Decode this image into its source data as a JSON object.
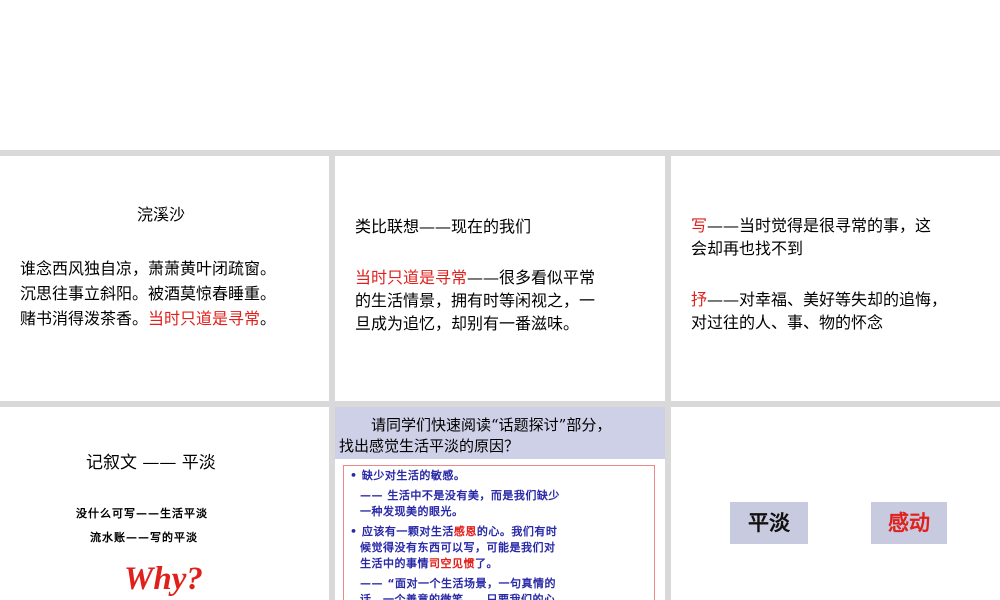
{
  "cell1": {
    "title": "浣溪沙",
    "line1": "谁念西风独自凉，萧萧黄叶闭疏窗。",
    "line2": "沉思往事立斜阳。被酒莫惊春睡重。",
    "line3_prefix": "赌书消得泼茶香。",
    "line3_highlight": "当时只道是寻常",
    "line3_suffix": "。"
  },
  "cell2": {
    "title": "类比联想——现在的我们",
    "highlight": "当时只道是寻常",
    "line1_rest": "——很多看似平常",
    "line2": "的生活情景，拥有时等闲视之，一",
    "line3": "旦成为追忆，却别有一番滋味。"
  },
  "cell3": {
    "a_key": "写",
    "a_line1_rest": "——当时觉得是很寻常的事，这",
    "a_line2": "会却再也找不到",
    "b_key": "抒",
    "b_line1_rest": "——对幸福、美好等失却的追悔，",
    "b_line2": "对过往的人、事、物的怀念"
  },
  "cell4": {
    "title": "记叙文 —— 平淡",
    "line1": "没什么可写——生活平淡",
    "line2": "流水账——写的平淡",
    "why": "Why?"
  },
  "cell5": {
    "question_line1": "请同学们快速阅读“话题探讨”部分，",
    "question_line2": "找出感觉生活平淡的原因？",
    "box": {
      "l1": "• 缺少对生活的敏感。",
      "l2": "—— 生活中不是没有美，而是我们缺少",
      "l3": "一种发现美的眼光。",
      "l4_a": "• 应该有一颗对生活",
      "l4_hl": "感恩",
      "l4_b": "的心。我们有时",
      "l5": "候觉得没有东西可以写，可能是我们对",
      "l6_a": "生活中的事情",
      "l6_hl": "司空见惯",
      "l6_b": "了。",
      "l7": "—— “面对一个生活场景，一句真情的",
      "l8": "话，一个善意的微笑……只要我们的心"
    }
  },
  "cell6": {
    "tag1": "平淡",
    "tag2": "感动"
  },
  "colors": {
    "highlight_red": "#e0201c",
    "box_text_blue": "#2a2aa8",
    "tag_bg": "#c8cbdf",
    "question_bg": "#cdd0e6",
    "grid_gap": "#d9d9d9"
  }
}
